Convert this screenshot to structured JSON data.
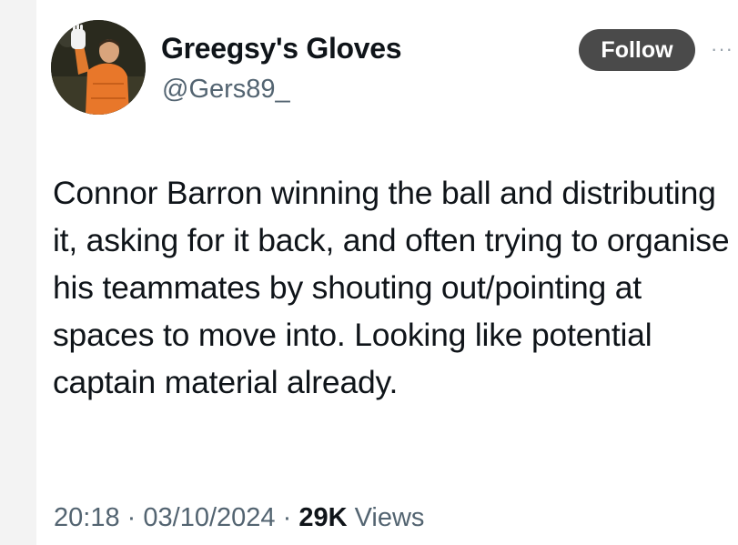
{
  "author": {
    "display_name": "Greegsy's Gloves",
    "handle": "@Gers89_"
  },
  "actions": {
    "follow_label": "Follow",
    "more_label": "···"
  },
  "tweet": {
    "text": "Connor Barron winning the ball and distributing it, asking for it back, and often trying to organise his teammates by shouting out/pointing at spaces to move into. Looking like potential captain material already."
  },
  "meta": {
    "time": "20:18",
    "separator": "·",
    "date": "03/10/2024",
    "views_count": "29K",
    "views_label": "Views"
  },
  "colors": {
    "text_primary": "#0f1419",
    "text_secondary": "#536471",
    "follow_button_bg": "#4a4a4a"
  }
}
